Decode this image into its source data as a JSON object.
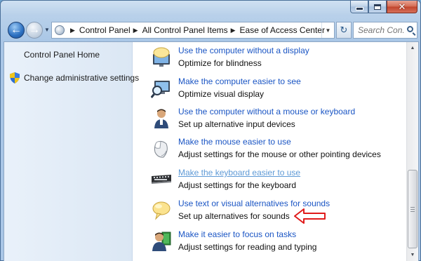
{
  "window": {
    "caption_buttons": {
      "minimize": "minimize-icon",
      "maximize": "maximize-icon",
      "close": "close-icon",
      "close_glyph": "✕"
    }
  },
  "nav": {
    "back_glyph": "←",
    "forward_glyph": "→",
    "breadcrumbs": [
      "Control Panel",
      "All Control Panel Items",
      "Ease of Access Center"
    ],
    "refresh_glyph": "↻",
    "search_placeholder": "Search Con..."
  },
  "sidebar": {
    "items": [
      {
        "label": "Control Panel Home",
        "icon": null
      },
      {
        "label": "Change administrative settings",
        "icon": "uac-shield-icon"
      }
    ]
  },
  "main": {
    "tasks": [
      {
        "link": "Use the computer without a display",
        "desc": "Optimize for blindness",
        "icon": "speech-bubble-monitor-icon"
      },
      {
        "link": "Make the computer easier to see",
        "desc": "Optimize visual display",
        "icon": "magnifier-monitor-icon"
      },
      {
        "link": "Use the computer without a mouse or keyboard",
        "desc": "Set up alternative input devices",
        "icon": "user-input-icon"
      },
      {
        "link": "Make the mouse easier to use",
        "desc": "Adjust settings for the mouse or other pointing devices",
        "icon": "mouse-icon"
      },
      {
        "link": "Make the keyboard easier to use",
        "desc": "Adjust settings for the keyboard",
        "icon": "keyboard-icon",
        "hovered": true
      },
      {
        "link": "Use text or visual alternatives for sounds",
        "desc": "Set up alternatives for sounds",
        "icon": "speech-bubble-icon"
      },
      {
        "link": "Make it easier to focus on tasks",
        "desc": "Adjust settings for reading and typing",
        "icon": "user-book-icon"
      }
    ]
  },
  "annotation": {
    "color": "#e01b1b",
    "icon": "red-arrow-icon"
  },
  "colors": {
    "link": "#1a55c4",
    "link_hover": "#5f9ad6",
    "sidebar_bg": "#e9f1fa",
    "frame": "#a9c6e6"
  }
}
